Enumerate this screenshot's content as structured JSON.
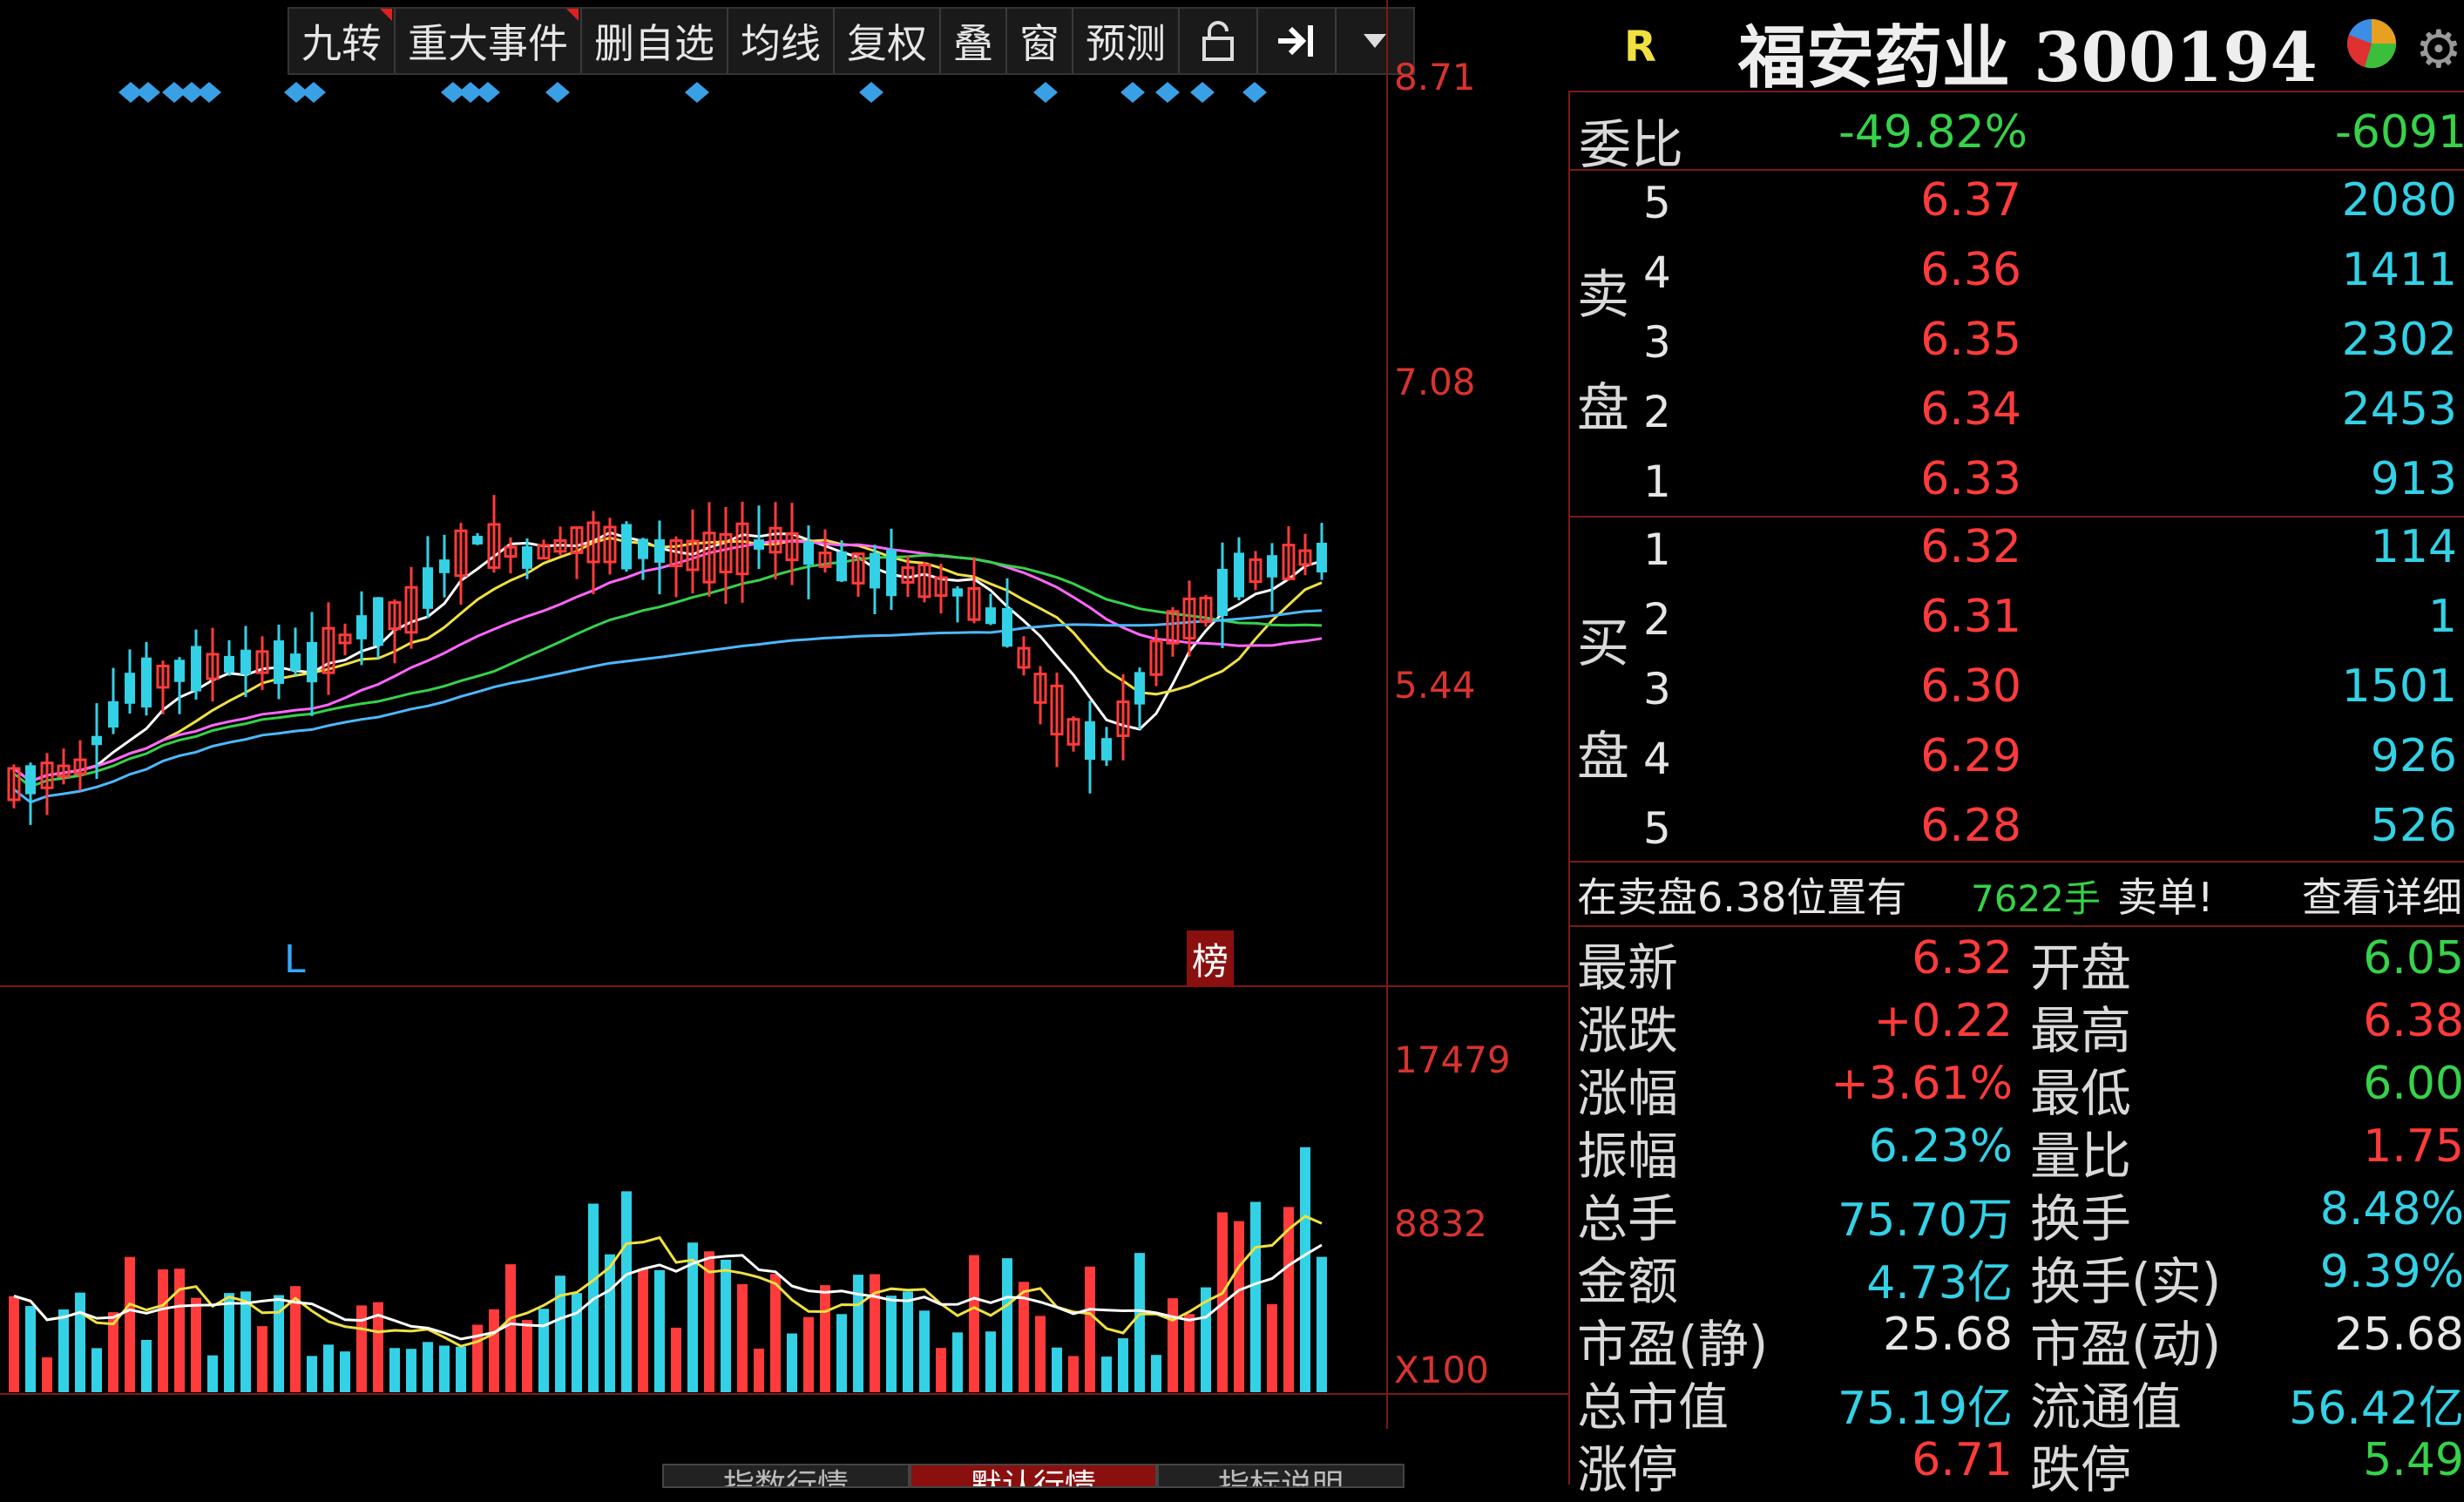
{
  "toolbar": {
    "items": [
      "九转",
      "重大事件",
      "删自选",
      "均线",
      "复权",
      "叠",
      "窗",
      "预测"
    ],
    "lock_icon": "lock-icon",
    "pin_icon": "arrow-to-right-icon",
    "dropdown_icon": "caret-down-icon"
  },
  "header": {
    "badge": "R",
    "title": "福安药业 300194"
  },
  "chart": {
    "price_axis": [
      "8.71",
      "7.08",
      "5.44"
    ],
    "volume_axis": [
      "17479",
      "8832",
      "X100"
    ],
    "marker_l": "L",
    "marker_bang": "榜"
  },
  "weibi": {
    "label": "委比",
    "percent": "-49.82%",
    "diff": "-6091"
  },
  "orderbook": {
    "sell_label_1": "卖",
    "sell_label_2": "盘",
    "buy_label_1": "买",
    "buy_label_2": "盘",
    "sell": [
      {
        "idx": "5",
        "price": "6.37",
        "vol": "2080"
      },
      {
        "idx": "4",
        "price": "6.36",
        "vol": "1411"
      },
      {
        "idx": "3",
        "price": "6.35",
        "vol": "2302"
      },
      {
        "idx": "2",
        "price": "6.34",
        "vol": "2453"
      },
      {
        "idx": "1",
        "price": "6.33",
        "vol": "913"
      }
    ],
    "buy": [
      {
        "idx": "1",
        "price": "6.32",
        "vol": "114"
      },
      {
        "idx": "2",
        "price": "6.31",
        "vol": "1"
      },
      {
        "idx": "3",
        "price": "6.30",
        "vol": "1501"
      },
      {
        "idx": "4",
        "price": "6.29",
        "vol": "926"
      },
      {
        "idx": "5",
        "price": "6.28",
        "vol": "526"
      }
    ]
  },
  "notice": {
    "prefix": "在卖盘6.38位置有",
    "amount": "7622手",
    "suffix": "卖单!",
    "link": "查看详细"
  },
  "quote": {
    "left": [
      {
        "label": "最新",
        "value": "6.32",
        "color": "red"
      },
      {
        "label": "涨跌",
        "value": "+0.22",
        "color": "red"
      },
      {
        "label": "涨幅",
        "value": "+3.61%",
        "color": "red"
      },
      {
        "label": "振幅",
        "value": "6.23%",
        "color": "cyan"
      },
      {
        "label": "总手",
        "value": "75.70万",
        "color": "cyan"
      },
      {
        "label": "金额",
        "value": "4.73亿",
        "color": "cyan"
      },
      {
        "label": "市盈(静)",
        "value": "25.68",
        "color": "white"
      },
      {
        "label": "总市值",
        "value": "75.19亿",
        "color": "cyan"
      },
      {
        "label": "涨停",
        "value": "6.71",
        "color": "red"
      }
    ],
    "right": [
      {
        "label": "开盘",
        "value": "6.05",
        "color": "green"
      },
      {
        "label": "最高",
        "value": "6.38",
        "color": "red"
      },
      {
        "label": "最低",
        "value": "6.00",
        "color": "green"
      },
      {
        "label": "量比",
        "value": "1.75",
        "color": "red"
      },
      {
        "label": "换手",
        "value": "8.48%",
        "color": "cyan"
      },
      {
        "label": "换手(实)",
        "value": "9.39%",
        "color": "cyan"
      },
      {
        "label": "市盈(动)",
        "value": "25.68",
        "color": "white"
      },
      {
        "label": "流通值",
        "value": "56.42亿",
        "color": "cyan"
      },
      {
        "label": "跌停",
        "value": "5.49",
        "color": "green"
      }
    ]
  },
  "bottom_tabs": [
    "指数行情",
    "默认行情",
    "指标说明"
  ],
  "colors": {
    "up": "#ff3b3b",
    "down": "#33d1e6",
    "grid": "#7a1a1a",
    "ma5": "#ffffff",
    "ma10": "#f0e040",
    "ma20": "#ff66ff",
    "ma30": "#36d24a",
    "ma60": "#4db8ff"
  }
}
